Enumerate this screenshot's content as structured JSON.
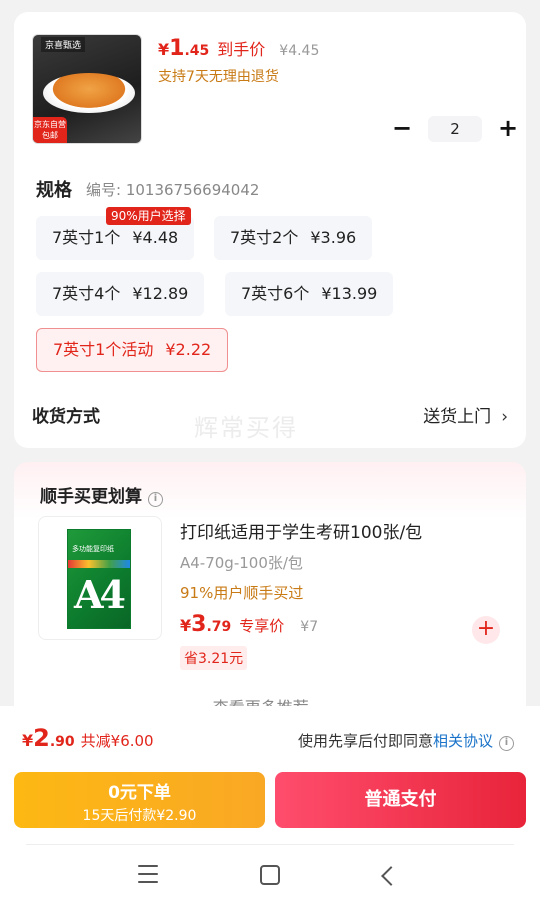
{
  "product": {
    "thumb_brand": "京喜甄选",
    "thumb_badge_line1": "京东自营",
    "thumb_badge_line2": "包邮",
    "price_symbol": "¥",
    "price_int": "1",
    "price_dec": ".45",
    "price_label": "到手价",
    "orig_price": "¥4.45",
    "return_note": "支持7天无理由退货",
    "quantity": "2"
  },
  "spec": {
    "title": "规格",
    "code": "编号: 10136756694042",
    "tag": "90%用户选择",
    "options": [
      {
        "name": "7英寸1个",
        "price": "¥4.48"
      },
      {
        "name": "7英寸2个",
        "price": "¥3.96"
      },
      {
        "name": "7英寸4个",
        "price": "¥12.89"
      },
      {
        "name": "7英寸6个",
        "price": "¥13.99"
      },
      {
        "name": "7英寸1个活动",
        "price": "¥2.22"
      }
    ]
  },
  "shipping": {
    "label": "收货方式",
    "value": "送货上门",
    "chevron": "›"
  },
  "watermark": "辉常买得",
  "recommend": {
    "title": "顺手买更划算",
    "info_icon": "i",
    "item": {
      "pack_label": "多功能复印纸",
      "pack_big": "A4",
      "title": "打印纸适用于学生考研100张/包",
      "spec": "A4-70g-100张/包",
      "popularity": "91%用户顺手买过",
      "price_symbol": "¥",
      "price_int": "3",
      "price_dec": ".79",
      "price_label": "专享价",
      "orig_price": "¥7",
      "save": "省3.21元",
      "add_icon": "+"
    },
    "more": "查看更多推荐 ⌄"
  },
  "summary": {
    "symbol": "¥",
    "price_int": "2",
    "price_dec": ".90",
    "discount": "共减¥6.00",
    "agree_text": "使用先享后付即同意",
    "agree_link": "相关协议",
    "info_icon": "i"
  },
  "buttons": {
    "later_line1": "0元下单",
    "later_line2": "15天后付款¥2.90",
    "pay": "普通支付"
  },
  "colors": {
    "accent": "#e1251b",
    "gold": "#c87a15",
    "link": "#1a73c9",
    "later_btn": "#fdb813",
    "pay_btn": "#e8243a"
  },
  "icons": {
    "minus": "−",
    "plus": "+"
  }
}
